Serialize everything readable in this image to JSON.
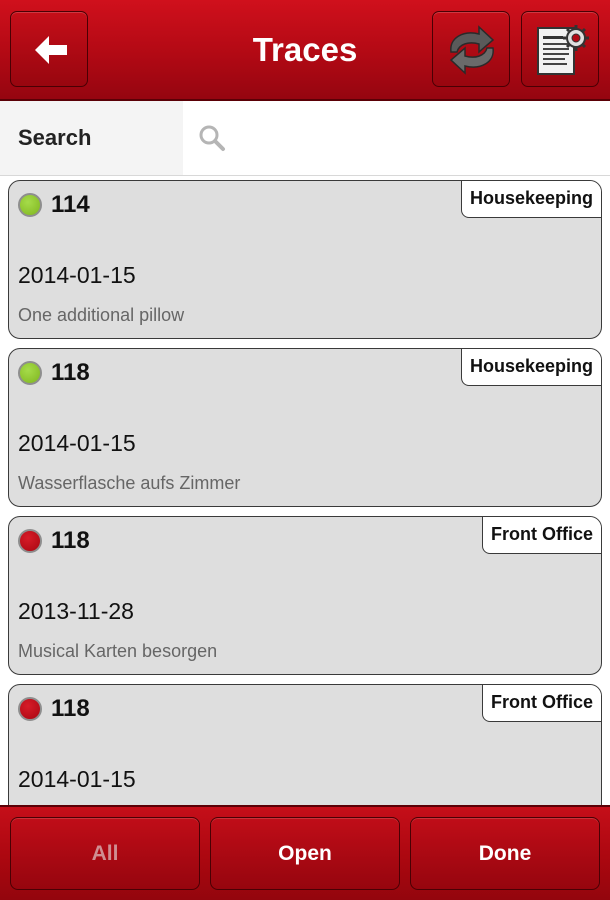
{
  "header": {
    "title": "Traces",
    "back_icon": "arrow-left-icon",
    "sync_icon": "sync-arrows-icon",
    "report_icon": "report-settings-icon"
  },
  "search": {
    "label": "Search",
    "value": "",
    "placeholder": "",
    "icon": "search-icon"
  },
  "traces": [
    {
      "room": "114",
      "status": "green",
      "department": "Housekeeping",
      "date": "2014-01-15",
      "description": "One additional pillow"
    },
    {
      "room": "118",
      "status": "green",
      "department": "Housekeeping",
      "date": "2014-01-15",
      "description": "Wasserflasche aufs Zimmer"
    },
    {
      "room": "118",
      "status": "red",
      "department": "Front Office",
      "date": "2013-11-28",
      "description": "Musical Karten besorgen"
    },
    {
      "room": "118",
      "status": "red",
      "department": "Front Office",
      "date": "2014-01-15",
      "description": ""
    }
  ],
  "filters": {
    "all_label": "All",
    "open_label": "Open",
    "done_label": "Done"
  },
  "colors": {
    "brand_red": "#b20914",
    "status_green": "#8fc52c",
    "status_red": "#c0101b",
    "card_background": "#dedede"
  }
}
